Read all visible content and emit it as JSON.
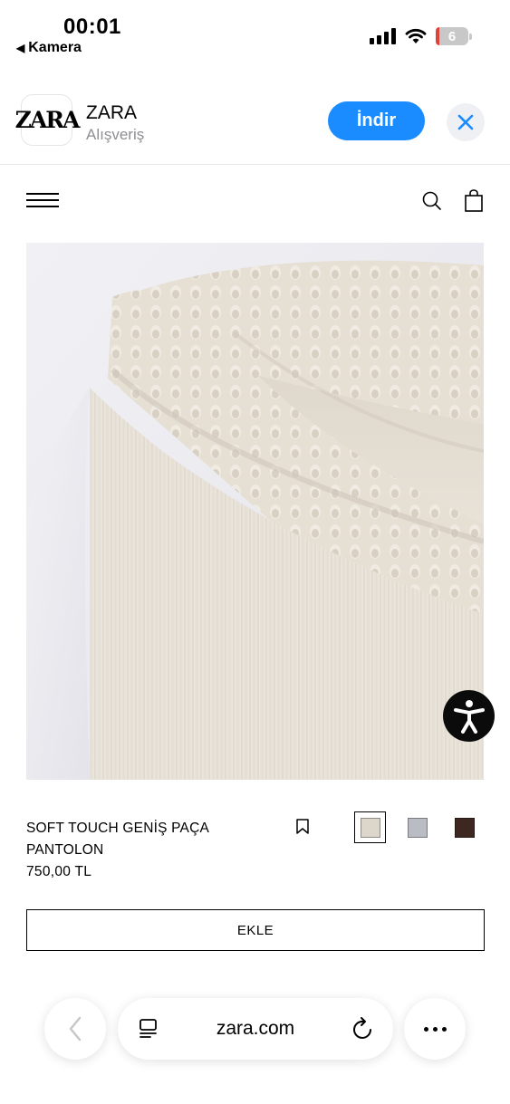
{
  "status_bar": {
    "time": "00:01",
    "back_app": "Kamera",
    "battery": "6"
  },
  "app_banner": {
    "logo_text": "ZARA",
    "name": "ZARA",
    "category": "Alışveriş",
    "get_label": "İndir"
  },
  "icons": {
    "menu": "hamburger-menu-icon",
    "search": "search-icon",
    "bag": "shopping-bag-icon",
    "bookmark": "bookmark-icon",
    "accessibility": "accessibility-icon",
    "back": "chevron-left-icon",
    "tabs": "tabs-icon",
    "reload": "reload-icon",
    "more": "more-icon"
  },
  "product": {
    "name": "SOFT TOUCH GENİŞ PAÇA PANTOLON",
    "price": "750,00 TL",
    "add_label": "EKLE",
    "swatches": [
      {
        "color": "#dcd6cb",
        "selected": true
      },
      {
        "color": "#b9bcc3",
        "selected": false
      },
      {
        "color": "#3d2720",
        "selected": false
      }
    ]
  },
  "browser": {
    "url": "zara.com"
  },
  "colors": {
    "accent": "#1a8cff",
    "secondary_text": "#8e8e93"
  }
}
